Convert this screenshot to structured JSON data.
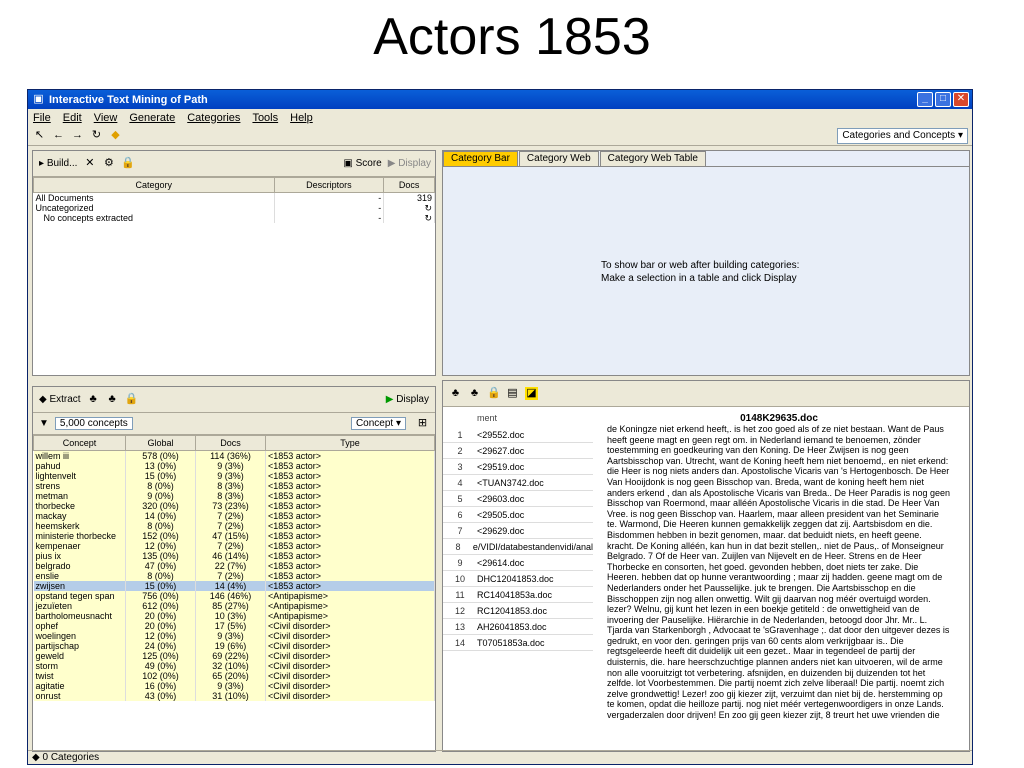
{
  "slide": {
    "title": "Actors 1853"
  },
  "window": {
    "title": "Interactive Text Mining of Path",
    "menu": [
      "File",
      "Edit",
      "View",
      "Generate",
      "Categories",
      "Tools",
      "Help"
    ],
    "view_select": "Categories and Concepts"
  },
  "categories_panel": {
    "build": "Build...",
    "score": "Score",
    "display": "Display",
    "columns": [
      "Category",
      "Descriptors",
      "Docs"
    ],
    "rows": [
      {
        "category": "All Documents",
        "descriptors": "-",
        "docs": "319"
      },
      {
        "category": "Uncategorized",
        "descriptors": "-",
        "docs": ""
      },
      {
        "category": "No concepts extracted",
        "descriptors": "-",
        "docs": ""
      }
    ]
  },
  "chart_panel": {
    "tabs": [
      "Category Bar",
      "Category Web",
      "Category Web Table"
    ],
    "message_line1": "To show bar or web after building categories:",
    "message_line2": "Make a selection in a table and click Display"
  },
  "concepts_panel": {
    "extract": "Extract",
    "display": "Display",
    "filter": "5,000 concepts",
    "concept_btn": "Concept",
    "columns": [
      "Concept",
      "Global",
      "Docs",
      "Type"
    ],
    "rows": [
      [
        "willem iii",
        "578 (0%)",
        "114 (36%)",
        "<1853 actor>"
      ],
      [
        "pahud",
        "13 (0%)",
        "9 (3%)",
        "<1853 actor>"
      ],
      [
        "lightenvelt",
        "15 (0%)",
        "9 (3%)",
        "<1853 actor>"
      ],
      [
        "strens",
        "8 (0%)",
        "8 (3%)",
        "<1853 actor>"
      ],
      [
        "metman",
        "9 (0%)",
        "8 (3%)",
        "<1853 actor>"
      ],
      [
        "thorbecke",
        "320 (0%)",
        "73 (23%)",
        "<1853 actor>"
      ],
      [
        "mackay",
        "14 (0%)",
        "7 (2%)",
        "<1853 actor>"
      ],
      [
        "heemskerk",
        "8 (0%)",
        "7 (2%)",
        "<1853 actor>"
      ],
      [
        "ministerie thorbecke",
        "152 (0%)",
        "47 (15%)",
        "<1853 actor>"
      ],
      [
        "kempenaer",
        "12 (0%)",
        "7 (2%)",
        "<1853 actor>"
      ],
      [
        "pius ix",
        "135 (0%)",
        "46 (14%)",
        "<1853 actor>"
      ],
      [
        "belgrado",
        "47 (0%)",
        "22 (7%)",
        "<1853 actor>"
      ],
      [
        "enslie",
        "8 (0%)",
        "7 (2%)",
        "<1853 actor>"
      ],
      [
        "zwijsen",
        "15 (0%)",
        "14 (4%)",
        "<1853 actor>"
      ],
      [
        "opstand tegen span",
        "756 (0%)",
        "146 (46%)",
        "<Antipapisme>"
      ],
      [
        "jezuïeten",
        "612 (0%)",
        "85 (27%)",
        "<Antipapisme>"
      ],
      [
        "bartholomeusnacht",
        "20 (0%)",
        "10 (3%)",
        "<Antipapisme>"
      ],
      [
        "ophef",
        "20 (0%)",
        "17 (5%)",
        "<Civil disorder>"
      ],
      [
        "woelingen",
        "12 (0%)",
        "9 (3%)",
        "<Civil disorder>"
      ],
      [
        "partijschap",
        "24 (0%)",
        "19 (6%)",
        "<Civil disorder>"
      ],
      [
        "geweld",
        "125 (0%)",
        "69 (22%)",
        "<Civil disorder>"
      ],
      [
        "storm",
        "49 (0%)",
        "32 (10%)",
        "<Civil disorder>"
      ],
      [
        "twist",
        "102 (0%)",
        "65 (20%)",
        "<Civil disorder>"
      ],
      [
        "agitatie",
        "16 (0%)",
        "9 (3%)",
        "<Civil disorder>"
      ],
      [
        "onrust",
        "43 (0%)",
        "31 (10%)",
        "<Civil disorder>"
      ]
    ]
  },
  "documents_panel": {
    "column": "ment",
    "doc_title": "0148K29635.doc",
    "docs": [
      "<29552.doc",
      "<29627.doc",
      "<29519.doc",
      "<TUAN3742.doc",
      "<29603.doc",
      "<29505.doc",
      "<29629.doc",
      "e/VIDI/databestandenvidi/anal",
      "<29614.doc",
      "DHC12041853.doc",
      "RC14041853a.doc",
      "RC12041853.doc",
      "AH26041853.doc",
      "T07051853a.doc"
    ],
    "text": "de Koningze niet erkend heeft,. is het zoo goed als of ze niet bestaan. Want de Paus heeft geene magt en geen regt om. in Nederland iemand te benoemen, zönder toestemming en goedkeuring van den Koning. De Heer Zwijsen is nog geen Aartsbisschop van. Utrecht, want de Koning heeft hem niet benoemd,. en niet erkend: die Heer is nog niets anders dan. Apostolische Vicaris van 's Hertogenbosch. De Heer Van Hooijdonk is nog geen Bisschop van. Breda, want de koning heeft hem niet anders erkend , dan als Apostolische Vicaris van Breda.. De Heer Paradis is nog geen Bisschop van Roermond, maar alléén Apostolische Vicaris in die stad. De Heer Van Vree. is nog geen Bisschop van. Haarlem, maar alleen president van het Seminarie te. Warmond, Die Heeren kunnen gemakkelijk zeggen dat zij. Aartsbisdom en die. Bisdommen hebben in bezit genomen, maar. dat beduidt niets, en heeft geene. kracht. De Koning alléén, kan hun in dat bezit stellen,. niet de Paus,. of Monseigneur Belgrado. 7 Of de Heer van. Zuijlen van Nijevelt en de Heer. Strens en de Heer Thorbecke en consorten, het goed. gevonden hebben, doet niets ter zake. Die Heeren. hebben dat op hunne verantwoording ; maar zij hadden. geene magt om de Nederlanders onder het Pausselijke. juk te brengen. Die Aartsbisschop en die Bisschoppen zijn nog allen onwettig. Wilt gij daarvan nog méér overtuigd worden. lezer? Welnu, gij kunt het lezen in een boekje getiteld : de onwettigheid van de invoering der Pauselijke. Hiërarchie in de Nederlanden, betoogd door Jhr. Mr.. L. Tjarda van Starkenborgh , Advocaat te 'sGravenhage ;. dat door den uitgever dezes is gedrukt, en voor den. geringen prijs van 60 cents alom verkrijgbaar is.. Die regtsgeleerde heeft dit duidelijk uit een gezet.. Maar in tegendeel de partij der duisternis, die. hare heerschzuchtige plannen anders niet kan uitvoeren, wil de arme non alle vooruitzigt tot verbetering. afsnijden, en duizenden bij duizenden tot het zelfde. lot Voorbestemmen. Die partij noemt zich zelve liberaal! Die partij. noemt zich zelve grondwettig! Lezer! zoo gij kiezer zijt, verzuimt dan niet bij de. herstemming op te komen, opdat die heilloze partij. nog niet méér vertegenwoordigers in onze Lands. vergaderzalen door drijven! En zoo gij geen kiezer zijt, 8 treurt het uwe vrienden die"
  },
  "status": {
    "text": "0 Categories"
  }
}
